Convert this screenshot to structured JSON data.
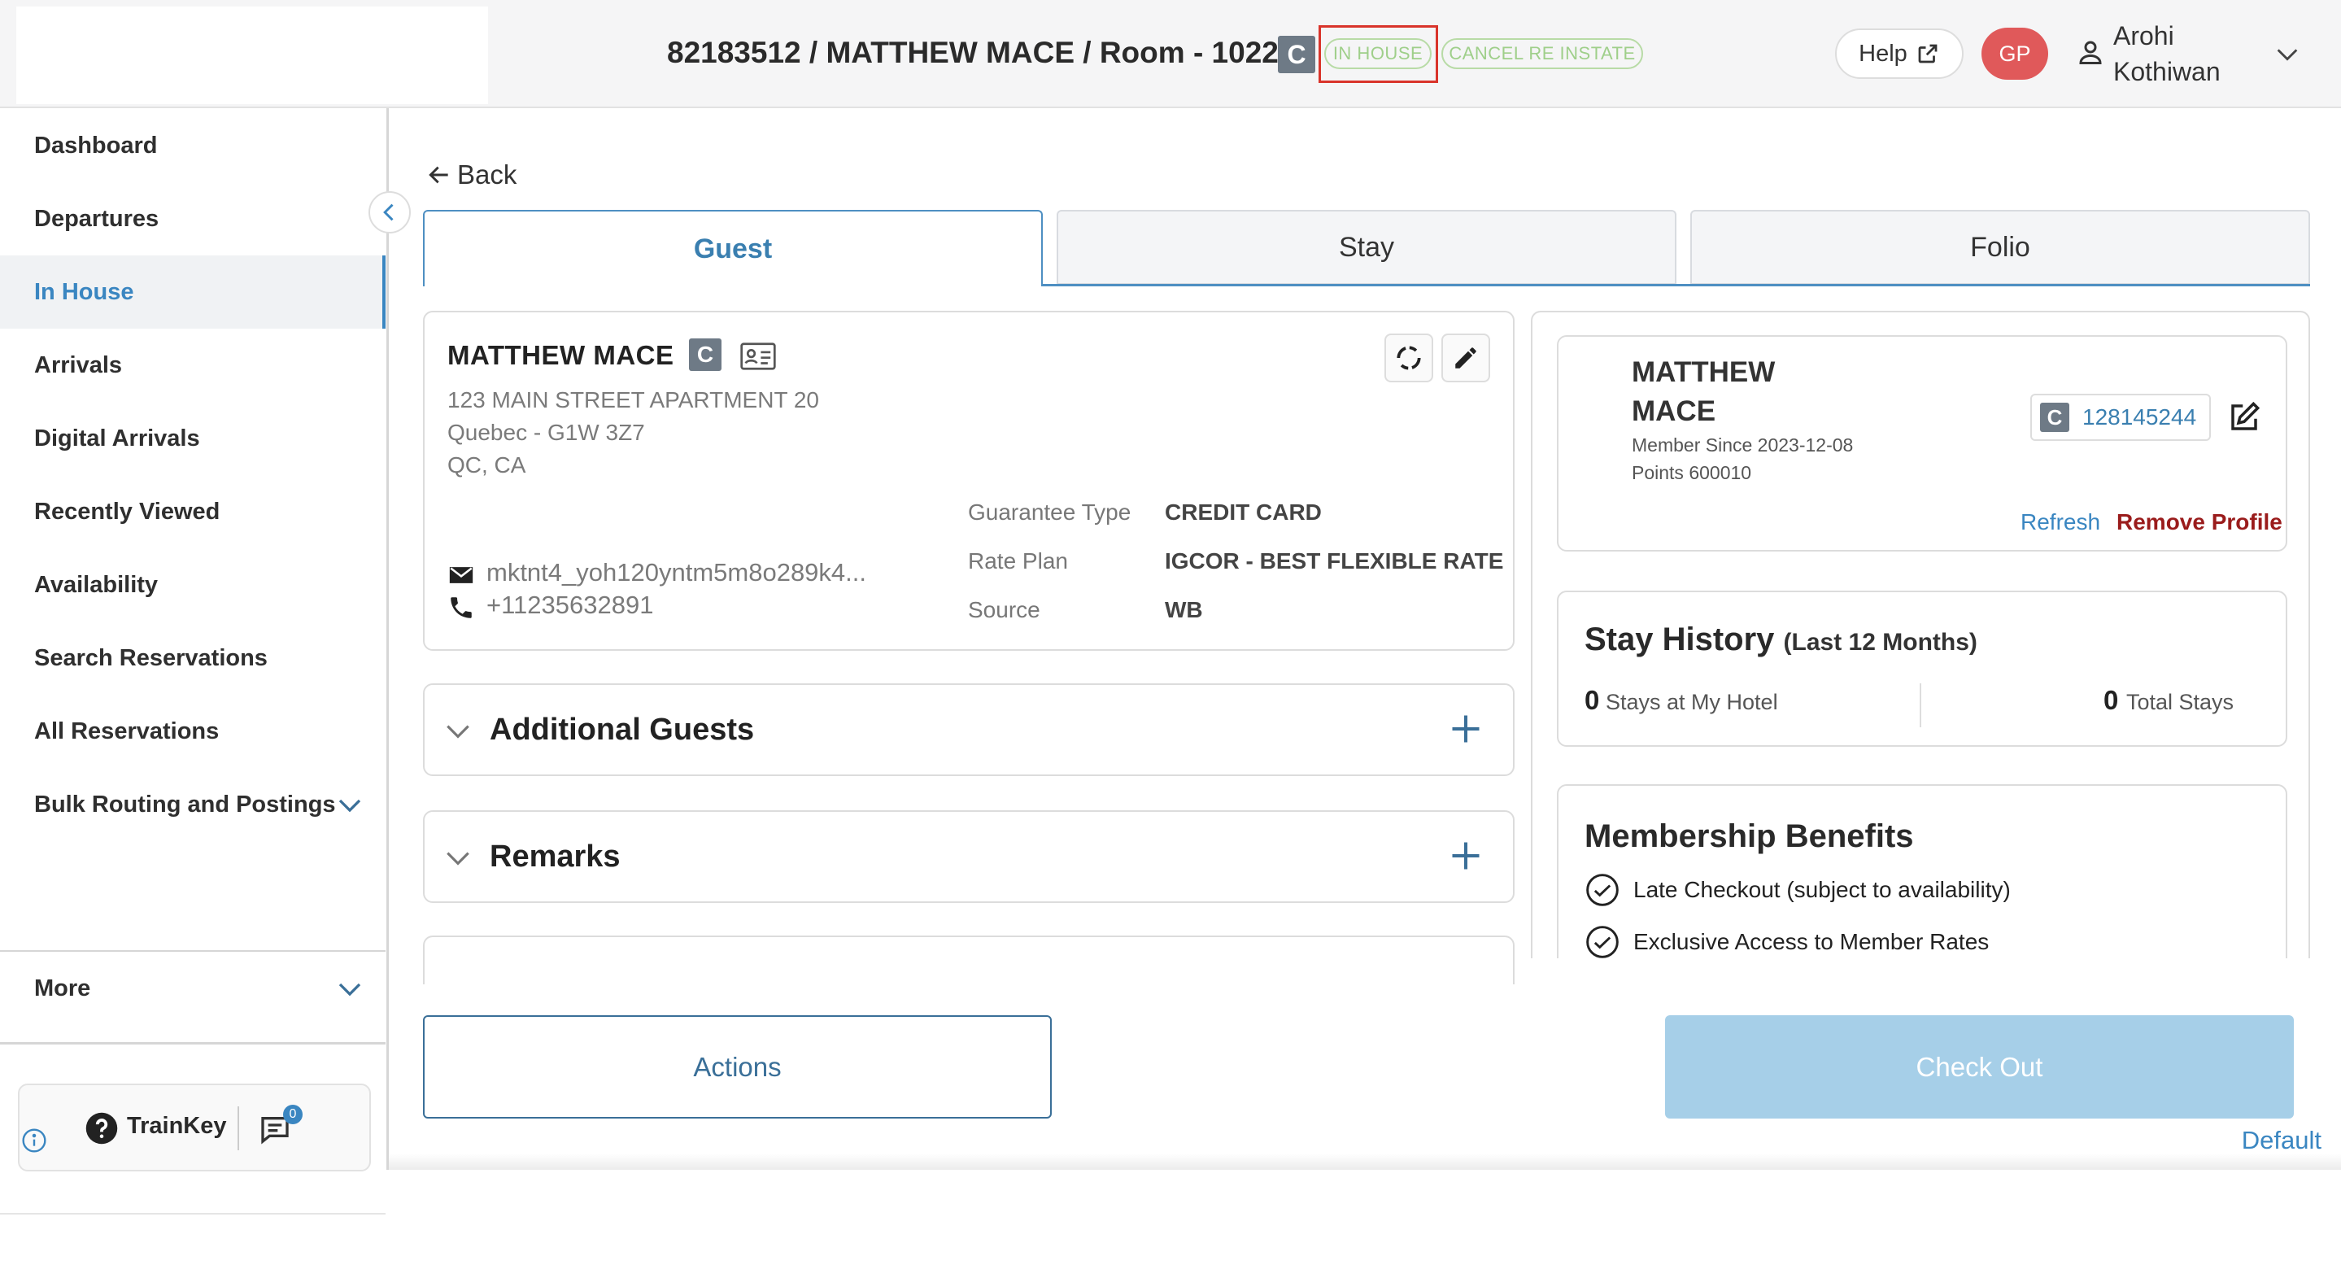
{
  "header": {
    "title": "82183512  / MATTHEW MACE  / Room - 1022",
    "brand_badge": "C",
    "status_in_house": "IN HOUSE",
    "status_cancel": "CANCEL RE INSTATE",
    "help_label": "Help",
    "avatar_initials": "GP",
    "user_name": "Arohi Kothiwan"
  },
  "sidebar": {
    "items": [
      {
        "label": "Dashboard"
      },
      {
        "label": "Departures"
      },
      {
        "label": "In House",
        "active": true
      },
      {
        "label": "Arrivals"
      },
      {
        "label": "Digital Arrivals"
      },
      {
        "label": "Recently Viewed"
      },
      {
        "label": "Availability"
      },
      {
        "label": "Search Reservations"
      },
      {
        "label": "All Reservations"
      },
      {
        "label": "Bulk Routing and Postings"
      },
      {
        "label": "More"
      }
    ],
    "trainkey_label": "TrainKey",
    "message_count": "0",
    "profile_label": "Default"
  },
  "main": {
    "back_label": "Back",
    "tabs": [
      {
        "label": "Guest",
        "active": true
      },
      {
        "label": "Stay"
      },
      {
        "label": "Folio"
      }
    ],
    "guest": {
      "name": "MATTHEW MACE",
      "badge": "C",
      "address_line1": "123 MAIN STREET APARTMENT 20",
      "address_line2": "Quebec  - G1W 3Z7",
      "address_line3": "QC, CA",
      "email": "mktnt4_yoh120yntm5m8o289k4...",
      "phone": "+11235632891",
      "details": [
        {
          "key": "Guarantee Type",
          "value": "CREDIT CARD"
        },
        {
          "key": "Rate Plan",
          "value": "IGCOR - BEST FLEXIBLE RATE"
        },
        {
          "key": "Source",
          "value": "WB"
        }
      ]
    },
    "accordions": [
      {
        "label": "Additional Guests"
      },
      {
        "label": "Remarks"
      }
    ],
    "membership": {
      "name": "MATTHEW MACE",
      "member_since": "Member Since 2023-12-08",
      "points": "Points 600010",
      "badge": "C",
      "member_number": "128145244",
      "refresh_label": "Refresh",
      "remove_label": "Remove Profile"
    },
    "stay_history": {
      "title": "Stay History",
      "subtitle": "(Last 12 Months)",
      "stays_here_count": "0",
      "stays_here_label": "Stays at My Hotel",
      "total_count": "0",
      "total_label": "Total Stays"
    },
    "benefits": {
      "title": "Membership Benefits",
      "items": [
        "Late Checkout (subject to availability)",
        "Exclusive Access to Member Rates"
      ]
    },
    "actions_label": "Actions",
    "checkout_label": "Check Out"
  },
  "colors": {
    "accent": "#3a86c1",
    "status_green": "#9fcf8a",
    "avatar": "#e0595a",
    "remove": "#9a1c1c",
    "checkout_disabled": "#a6cfe8",
    "highlight_box": "#d9342b"
  }
}
